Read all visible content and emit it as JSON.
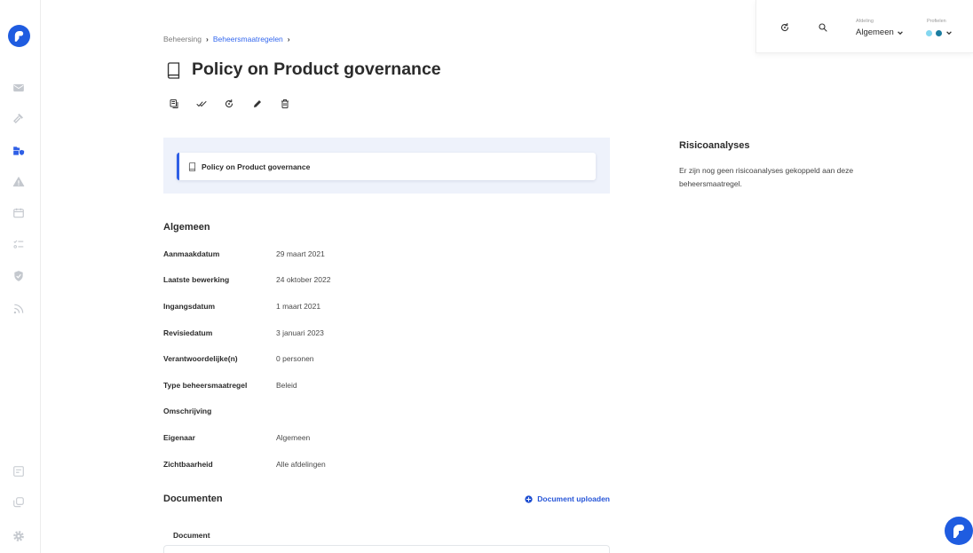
{
  "app": {
    "logo_icon": "logo-icon",
    "accent_color": "#2f5fe6"
  },
  "sidebar": {
    "items": [
      {
        "icon": "mail-icon"
      },
      {
        "icon": "hammer-icon"
      },
      {
        "icon": "folder-shield-icon",
        "active": true
      },
      {
        "icon": "warning-icon"
      },
      {
        "icon": "calendar-icon"
      },
      {
        "icon": "checklist-icon"
      },
      {
        "icon": "shield-check-icon"
      },
      {
        "icon": "rss-icon"
      }
    ],
    "bottom_items": [
      {
        "icon": "list-icon"
      },
      {
        "icon": "copy-icon"
      },
      {
        "icon": "gear-icon"
      }
    ]
  },
  "header": {
    "refresh_icon": "refresh-icon",
    "search_icon": "search-icon",
    "department": {
      "label": "Afdeling",
      "value": "Algemeen"
    },
    "profiles": {
      "label": "Profielen",
      "dots": [
        "#84d7f0",
        "#1b7da0"
      ]
    }
  },
  "breadcrumb": {
    "separator": "›",
    "items": [
      {
        "label": "Beheersing"
      },
      {
        "label": "Beheersmaatregelen"
      }
    ]
  },
  "page": {
    "title": "Policy on Product governance",
    "title_icon": "book-icon"
  },
  "toolbar": [
    {
      "icon": "report-icon"
    },
    {
      "icon": "double-check-icon"
    },
    {
      "icon": "refresh-icon"
    },
    {
      "icon": "pencil-icon"
    },
    {
      "icon": "trash-icon"
    }
  ],
  "linked_items": [
    {
      "icon": "book-icon",
      "title": "Policy on Product governance"
    }
  ],
  "general": {
    "heading": "Algemeen",
    "rows": [
      {
        "label": "Aanmaakdatum",
        "value": "29 maart 2021"
      },
      {
        "label": "Laatste bewerking",
        "value": "24 oktober 2022"
      },
      {
        "label": "Ingangsdatum",
        "value": "1 maart 2021"
      },
      {
        "label": "Revisiedatum",
        "value": "3 januari 2023"
      },
      {
        "label": "Verantwoordelijke(n)",
        "value": "0 personen"
      },
      {
        "label": "Type beheersmaatregel",
        "value": "Beleid"
      },
      {
        "label": "Omschrijving",
        "value": ""
      },
      {
        "label": "Eigenaar",
        "value": "Algemeen"
      },
      {
        "label": "Zichtbaarheid",
        "value": "Alle afdelingen"
      }
    ]
  },
  "documents": {
    "heading": "Documenten",
    "upload_label": "Document uploaden",
    "upload_icon": "plus-circle-icon",
    "columns": [
      "Document"
    ]
  },
  "risk_analyses": {
    "heading": "Risicoanalyses",
    "empty_text": "Er zijn nog geen risicoanalyses gekoppeld aan deze beheersmaatregel."
  },
  "chat": {
    "icon": "chat-logo-icon"
  }
}
